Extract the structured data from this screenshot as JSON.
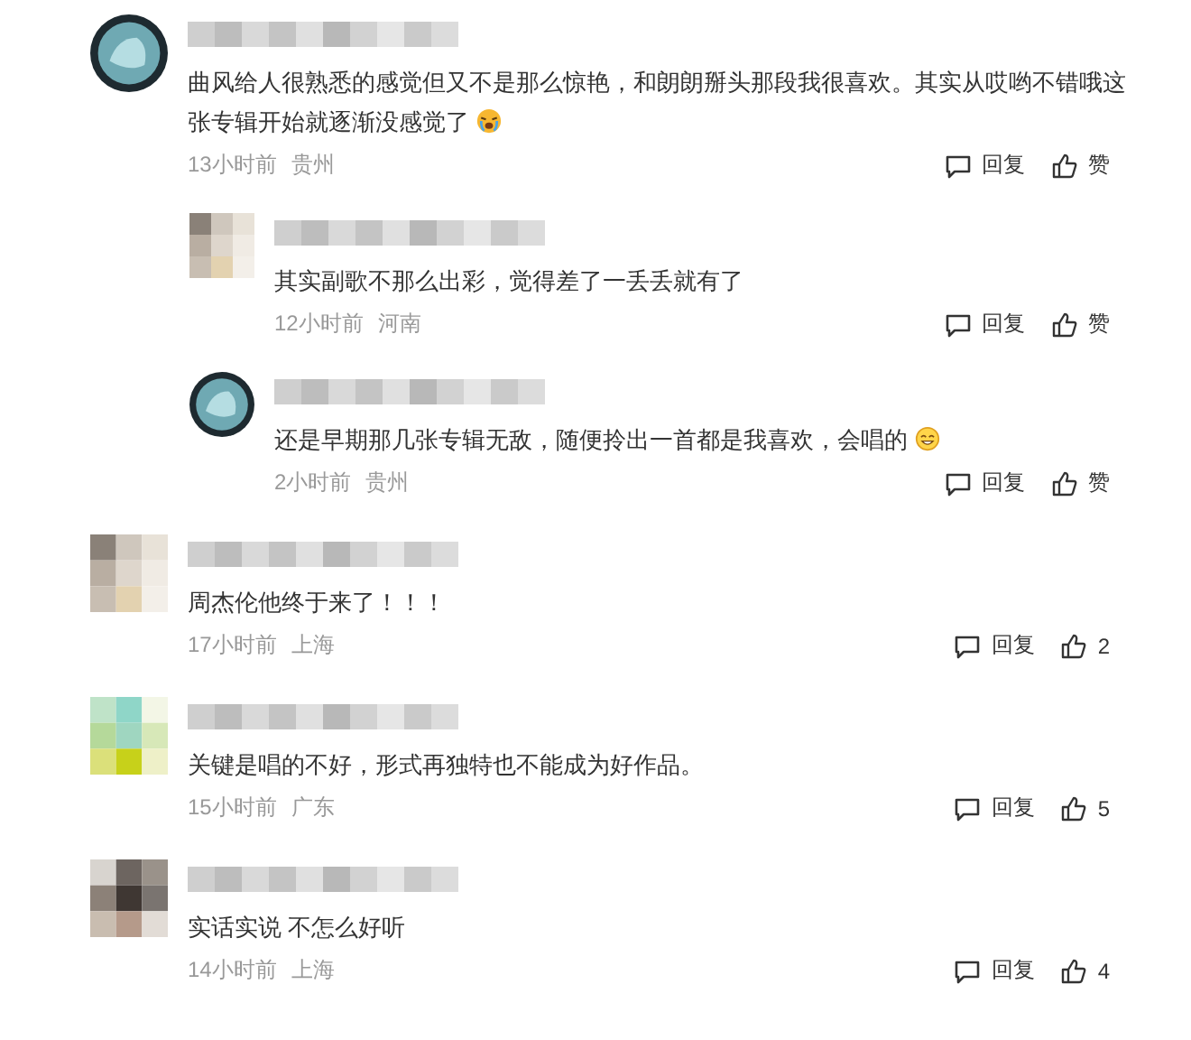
{
  "comments": [
    {
      "avatar": {
        "kind": "round"
      },
      "text": "曲风给人很熟悉的感觉但又不是那么惊艳，和朗朗掰头那段我很喜欢。其实从哎哟不错哦这张专辑开始就逐渐没感觉了",
      "emoji": {
        "kind": "cry"
      },
      "time": "13小时前",
      "location": "贵州",
      "reply": "回复",
      "like": "赞",
      "replies": [
        {
          "avatar": {
            "kind": "mosaic"
          },
          "text": "其实副歌不那么出彩，觉得差了一丢丢就有了",
          "time": "12小时前",
          "location": "河南",
          "reply": "回复",
          "like": "赞"
        },
        {
          "avatar": {
            "kind": "round"
          },
          "text": "还是早期那几张专辑无敌，随便拎出一首都是我喜欢，会唱的",
          "emoji": {
            "kind": "smile"
          },
          "time": "2小时前",
          "location": "贵州",
          "reply": "回复",
          "like": "赞"
        }
      ]
    },
    {
      "avatar": {
        "kind": "mosaic"
      },
      "text": "周杰伦他终于来了！！！",
      "time": "17小时前",
      "location": "上海",
      "reply": "回复",
      "like": "2"
    },
    {
      "avatar": {
        "kind": "mosaic-green"
      },
      "text": "关键是唱的不好，形式再独特也不能成为好作品。",
      "time": "15小时前",
      "location": "广东",
      "reply": "回复",
      "like": "5"
    },
    {
      "avatar": {
        "kind": "mosaic-dark"
      },
      "text": "实话实说 不怎么好听",
      "time": "14小时前",
      "location": "上海",
      "reply": "回复",
      "like": "4"
    }
  ]
}
